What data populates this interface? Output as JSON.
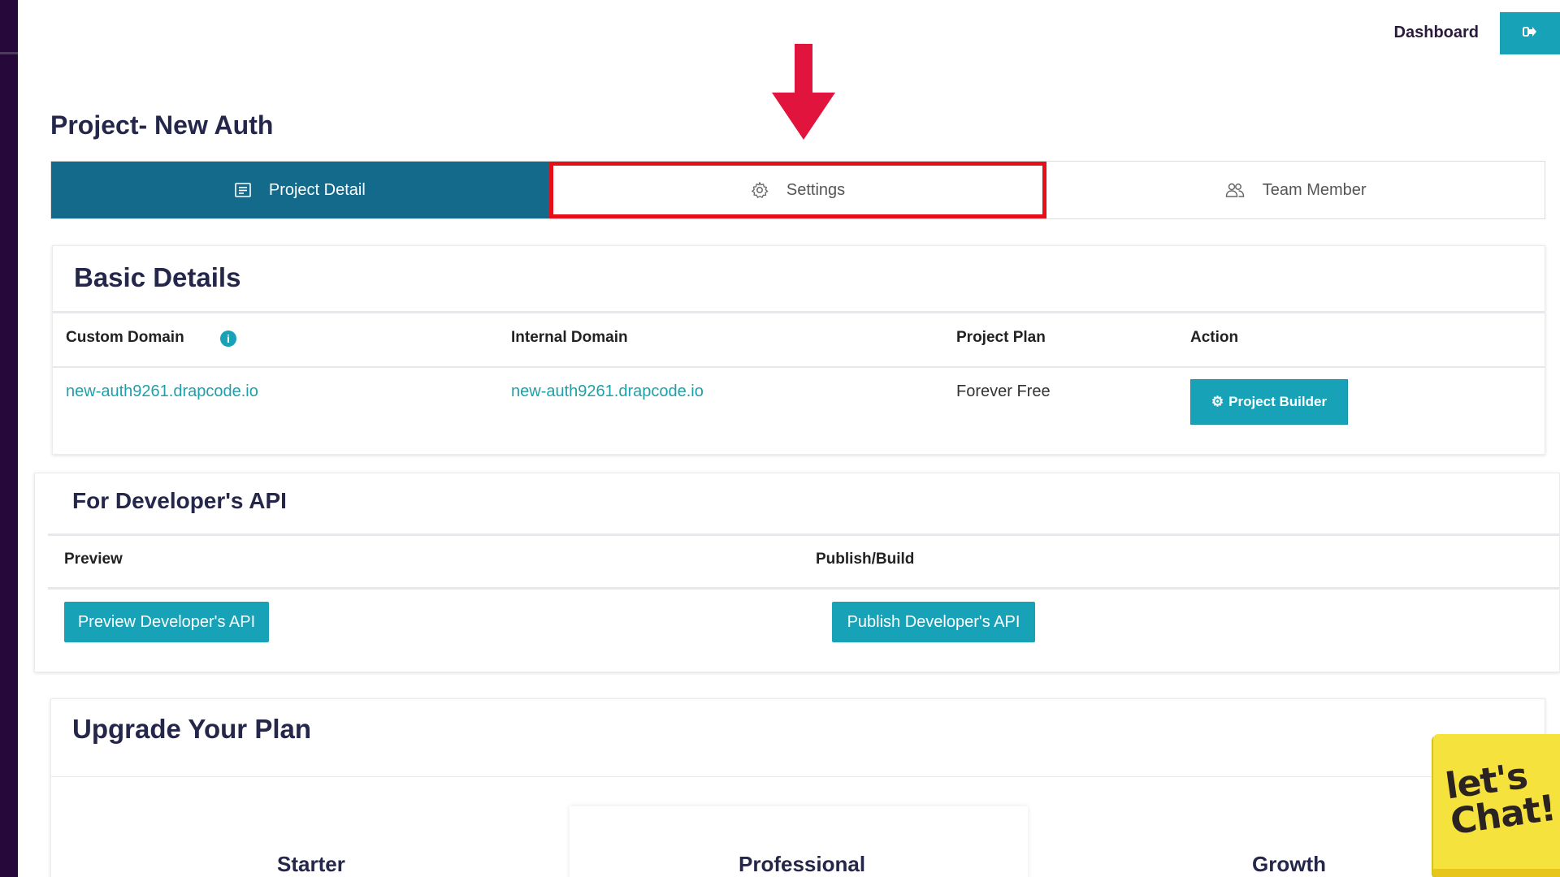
{
  "header": {
    "dashboard_label": "Dashboard"
  },
  "page": {
    "title": "Project- New Auth"
  },
  "tabs": [
    {
      "label": "Project Detail",
      "icon": "document-icon",
      "active": true
    },
    {
      "label": "Settings",
      "icon": "gear-icon",
      "highlighted": true
    },
    {
      "label": "Team Member",
      "icon": "users-icon"
    }
  ],
  "basic_details": {
    "title": "Basic Details",
    "columns": [
      "Custom Domain",
      "Internal Domain",
      "Project Plan",
      "Action"
    ],
    "row": {
      "custom_domain": "new-auth9261.drapcode.io",
      "internal_domain": "new-auth9261.drapcode.io",
      "project_plan": "Forever Free",
      "action_label": "Project Builder"
    }
  },
  "developer_api": {
    "title": "For Developer's API",
    "columns": [
      "Preview",
      "Publish/Build"
    ],
    "preview_button": "Preview Developer's API",
    "publish_button": "Publish Developer's API"
  },
  "upgrade": {
    "title": "Upgrade Your Plan",
    "plans": [
      "Starter",
      "Professional",
      "Growth"
    ]
  },
  "chat_widget": {
    "label": "let's Chat!"
  },
  "colors": {
    "accent": "#17a2b8",
    "active_tab": "#136a8a",
    "highlight_box": "#e3101a",
    "arrow": "#e0143c",
    "sidebar": "#26083b"
  }
}
